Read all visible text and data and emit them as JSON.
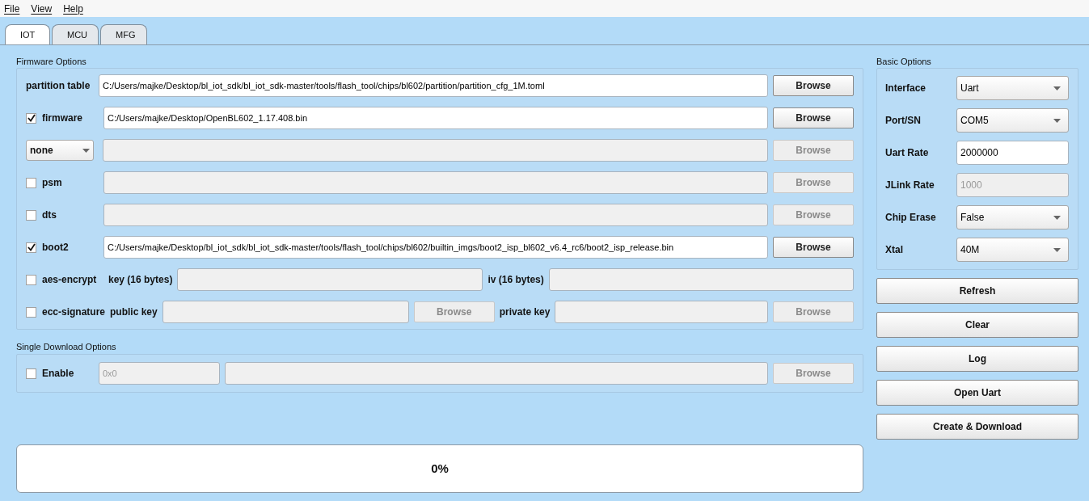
{
  "menu": [
    "File",
    "View",
    "Help"
  ],
  "tabs": [
    {
      "label": "IOT",
      "selected": true
    },
    {
      "label": "MCU",
      "selected": false
    },
    {
      "label": "MFG",
      "selected": false
    }
  ],
  "firmware_options": {
    "title": "Firmware Options",
    "rows": [
      {
        "kind": "file",
        "label": "partition table",
        "path": {
          "value": "C:/Users/majke/Desktop/bl_iot_sdk/bl_iot_sdk-master/tools/flash_tool/chips/bl602/partition/partition_cfg_1M.toml",
          "disabled": false
        },
        "browse": {
          "label": "Browse",
          "disabled": false
        }
      },
      {
        "kind": "check_file",
        "label": "firmware",
        "checked": true,
        "path": {
          "value": "C:/Users/majke/Desktop/OpenBL602_1.17.408.bin",
          "disabled": false
        },
        "browse": {
          "label": "Browse",
          "disabled": false
        }
      },
      {
        "kind": "select_file",
        "select": "none",
        "path": {
          "disabled": true
        },
        "browse": {
          "label": "Browse",
          "disabled": true
        }
      },
      {
        "kind": "check_file",
        "label": "psm",
        "checked": false,
        "path": {
          "disabled": true
        },
        "browse": {
          "label": "Browse",
          "disabled": true
        }
      },
      {
        "kind": "check_file",
        "label": "dts",
        "checked": false,
        "path": {
          "disabled": true
        },
        "browse": {
          "label": "Browse",
          "disabled": true
        }
      },
      {
        "kind": "check_file",
        "label": "boot2",
        "checked": true,
        "path": {
          "value": "C:/Users/majke/Desktop/bl_iot_sdk/bl_iot_sdk-master/tools/flash_tool/chips/bl602/builtin_imgs/boot2_isp_bl602_v6.4_rc6/boot2_isp_release.bin",
          "disabled": false
        },
        "browse": {
          "label": "Browse",
          "disabled": false
        }
      },
      {
        "kind": "aes",
        "label": "aes-encrypt",
        "checked": false,
        "key_label": "key (16 bytes)",
        "iv_label": "iv (16 bytes)"
      },
      {
        "kind": "ecc",
        "label": "ecc-signature",
        "checked": false,
        "public_label": "public key",
        "public_browse": {
          "label": "Browse",
          "disabled": true
        },
        "private_label": "private key",
        "private_browse": {
          "label": "Browse",
          "disabled": true
        }
      }
    ]
  },
  "single_download": {
    "title": "Single Download Options",
    "enable": {
      "label": "Enable",
      "checked": false
    },
    "address": {
      "placeholder": "0x0"
    },
    "browse": {
      "label": "Browse",
      "disabled": true
    }
  },
  "progress": {
    "text": "0%",
    "level": 0
  },
  "basic_options": {
    "title": "Basic Options",
    "fields": [
      {
        "kind": "select",
        "label": "Interface",
        "value": "Uart",
        "disabled": false
      },
      {
        "kind": "select",
        "label": "Port/SN",
        "value": "COM5",
        "disabled": false
      },
      {
        "kind": "input",
        "label": "Uart Rate",
        "value": "2000000",
        "disabled": false
      },
      {
        "kind": "input",
        "label": "JLink Rate",
        "value": "1000",
        "disabled": true
      },
      {
        "kind": "select",
        "label": "Chip Erase",
        "value": "False",
        "disabled": false
      },
      {
        "kind": "select",
        "label": "Xtal",
        "value": "40M",
        "disabled": false
      }
    ]
  },
  "actions": [
    "Refresh",
    "Clear",
    "Log",
    "Open Uart",
    "Create & Download"
  ]
}
